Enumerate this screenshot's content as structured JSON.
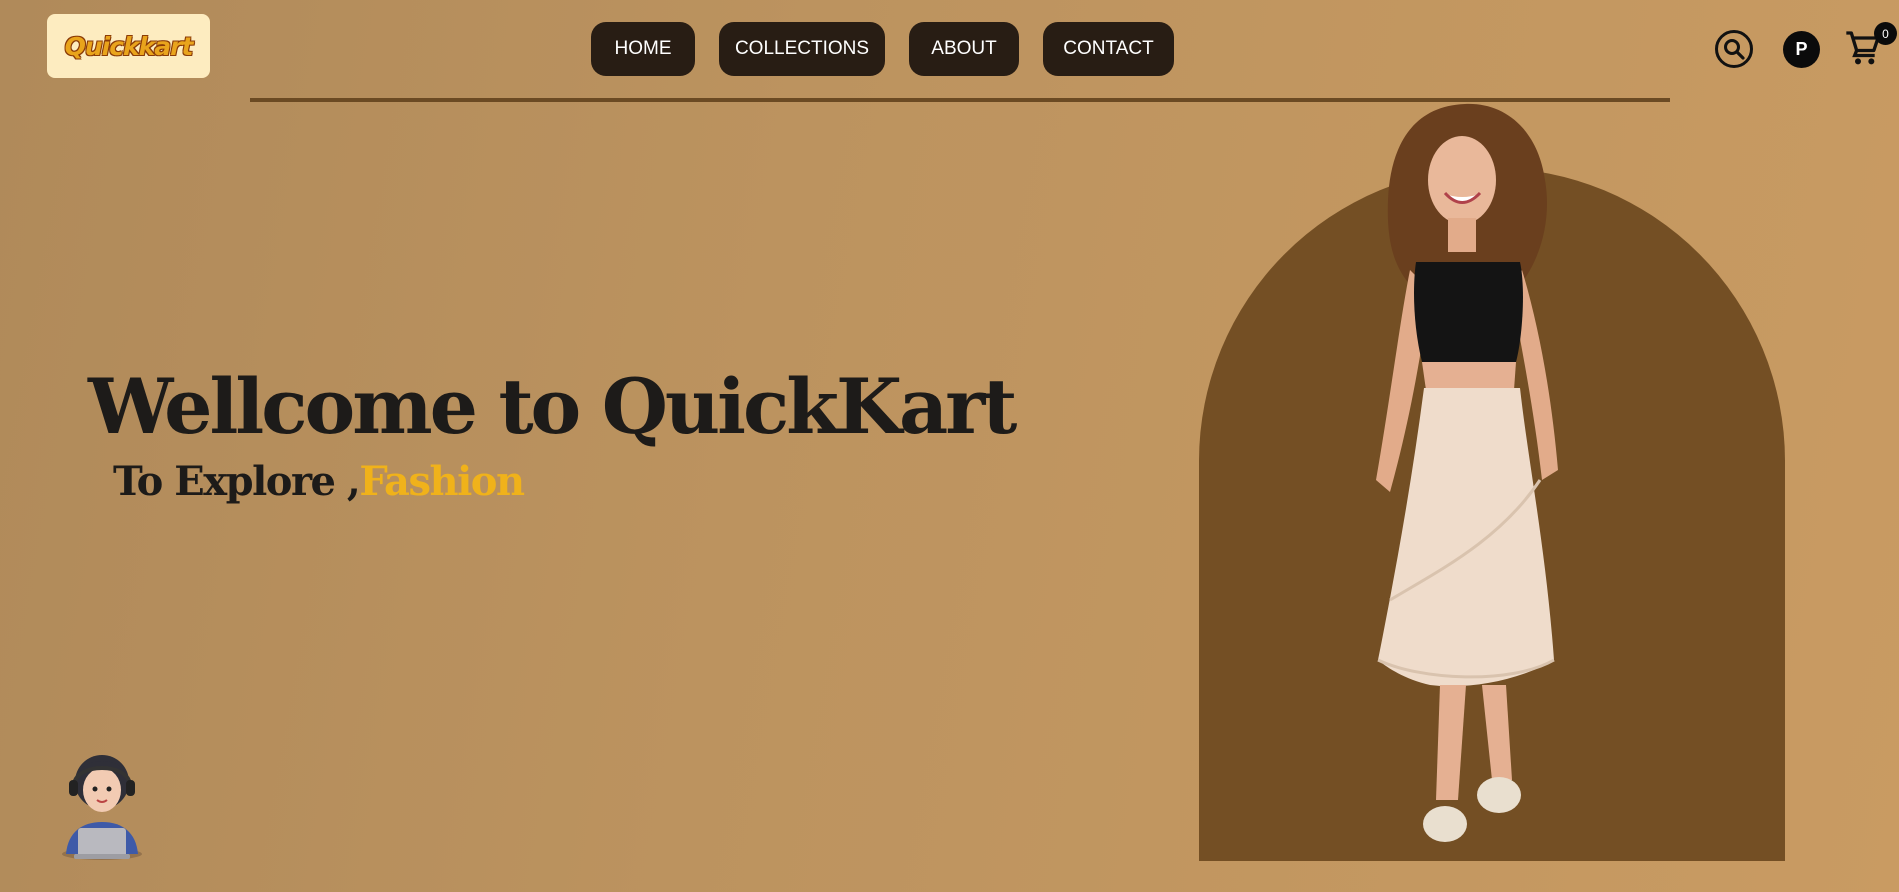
{
  "header": {
    "logo_text": "Quickkart",
    "nav": [
      {
        "label": "HOME"
      },
      {
        "label": "COLLECTIONS"
      },
      {
        "label": "ABOUT"
      },
      {
        "label": "CONTACT"
      }
    ],
    "icons": {
      "search": "search-icon",
      "profile_initial": "P",
      "cart": "cart-icon",
      "cart_count": "0"
    }
  },
  "hero": {
    "title": "Wellcome to QuickKart",
    "subtitle_prefix": "To Explore ,",
    "subtitle_accent": "Fashion",
    "model_image": "fashion-model-photo"
  },
  "support": {
    "icon": "support-agent-icon"
  },
  "colors": {
    "background": "#bc935f",
    "nav_button": "#281d14",
    "arch": "#744f24",
    "accent": "#f0b21a",
    "logo_bg": "#fdecc0",
    "divider": "#6b4a23"
  }
}
